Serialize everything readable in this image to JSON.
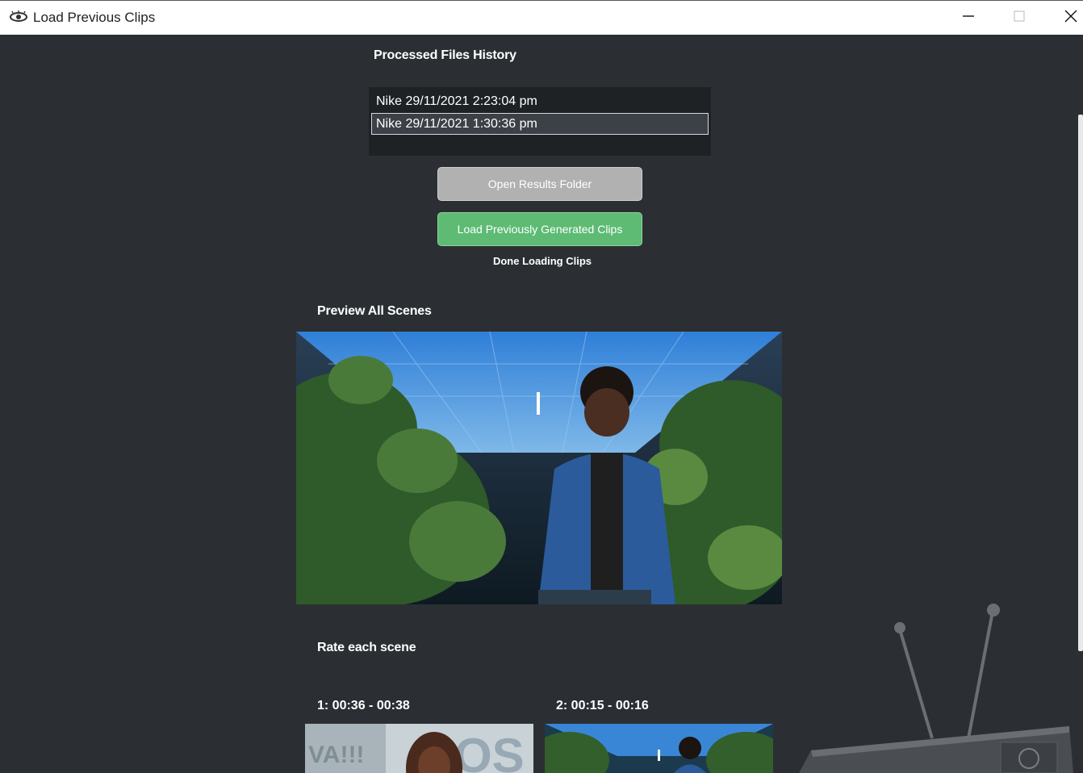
{
  "window": {
    "title": "Load Previous Clips",
    "app_icon": "eye-icon",
    "controls": [
      "minimize-icon",
      "maximize-icon",
      "close-icon"
    ]
  },
  "history": {
    "heading": "Processed Files History",
    "items": [
      {
        "label": "Nike 29/11/2021 2:23:04 pm",
        "selected": false
      },
      {
        "label": "Nike 29/11/2021 1:30:36 pm",
        "selected": true
      }
    ]
  },
  "actions": {
    "open_results_label": "Open Results Folder",
    "load_clips_label": "Load Previously Generated Clips",
    "status": "Done Loading Clips"
  },
  "preview": {
    "heading": "Preview All Scenes"
  },
  "rating": {
    "heading": "Rate each scene",
    "scenes": [
      {
        "label": "1: 00:36 - 00:38",
        "thumb_text": "VA!!!"
      },
      {
        "label": "2: 00:15 - 00:16"
      }
    ]
  },
  "colors": {
    "background": "#2b2f33",
    "accent_green": "#5dbb74",
    "button_grey": "#b1b1b1"
  }
}
